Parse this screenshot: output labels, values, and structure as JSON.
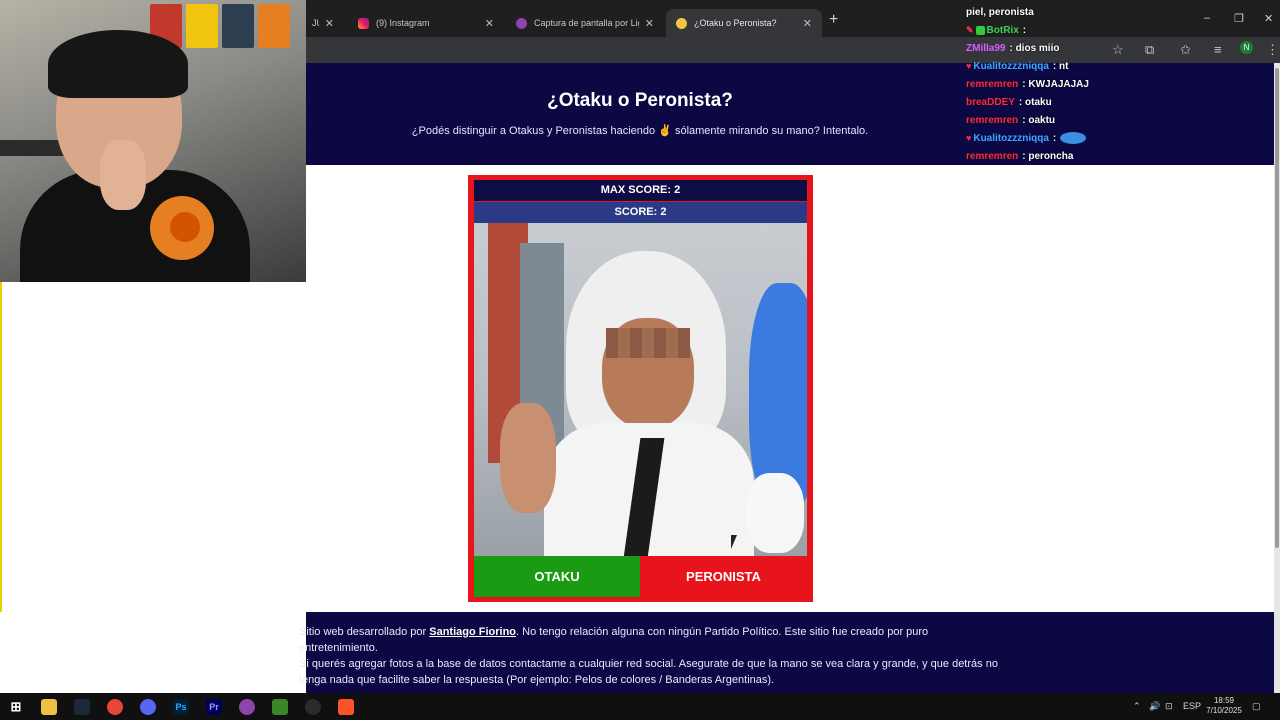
{
  "browser": {
    "tabs": [
      {
        "label": "JUE",
        "active": false
      },
      {
        "label": "(9) Instagram",
        "active": false
      },
      {
        "label": "Captura de pantalla por Lightsh...",
        "active": false
      },
      {
        "label": "¿Otaku o Peronista?",
        "active": true
      }
    ],
    "new_tab": "+",
    "close": "✕",
    "win_min": "–",
    "win_max": "❐",
    "win_close": "✕",
    "profile_initial": "N"
  },
  "page": {
    "title": "¿Otaku o Peronista?",
    "subtitle": "¿Podés distinguir a Otakus y Peronistas haciendo ✌ sólamente mirando su mano? Intentalo."
  },
  "game": {
    "max_score": "MAX SCORE: 2",
    "score": "SCORE: 2",
    "btn_otaku": "OTAKU",
    "btn_peronista": "PERONISTA"
  },
  "footer": {
    "p1_before": "Sitio web desarrollado por ",
    "p1_link": "Santiago Fiorino",
    "p1_after": ". No tengo relación alguna con ningún Partido Político. Este sitio fue creado por puro entretenimiento.",
    "p2": "Si querés agregar fotos a la base de datos contactame a cualquier red social. Asegurate de que la mano se vea clara y grande, y que detrás no tenga nada que facilite saber la respuesta (Por ejemplo: Pelos de colores / Banderas Argentinas)."
  },
  "chat": [
    {
      "user": "",
      "msg": "piel, peronista",
      "color": "#ffffff"
    },
    {
      "user": "BotRix",
      "msg": "",
      "color": "#39d353"
    },
    {
      "user": "ZMilla99",
      "msg": "dios miio",
      "color": "#d95cff"
    },
    {
      "user": "Kualitozzzniqqa",
      "msg": "nt",
      "color": "#3ea6ff"
    },
    {
      "user": "remremren",
      "msg": "KWJAJAJAJ",
      "color": "#ff2a2a"
    },
    {
      "user": "breaDDEY",
      "msg": "otaku",
      "color": "#ff2a2a"
    },
    {
      "user": "remremren",
      "msg": "oaktu",
      "color": "#ff2a2a"
    },
    {
      "user": "Kualitozzzniqqa",
      "msg": "",
      "color": "#3ea6ff"
    },
    {
      "user": "remremren",
      "msg": "peroncha",
      "color": "#ff2a2a"
    }
  ],
  "taskbar": {
    "lang": "ESP",
    "time": "18:59",
    "date": "7/10/2025"
  }
}
